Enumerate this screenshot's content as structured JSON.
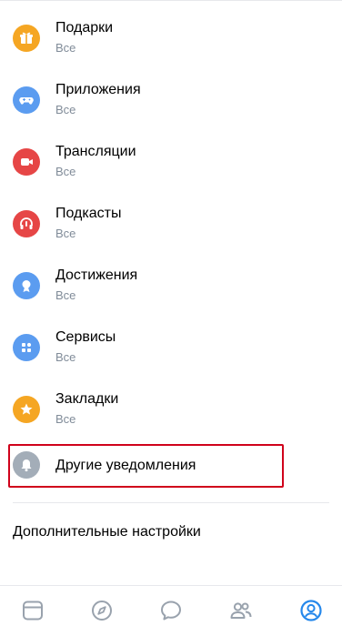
{
  "items": [
    {
      "title": "Подарки",
      "subtitle": "Все",
      "icon": "gift-icon",
      "color": "#f5a623"
    },
    {
      "title": "Приложения",
      "subtitle": "Все",
      "icon": "gamepad-icon",
      "color": "#5b9cf0"
    },
    {
      "title": "Трансляции",
      "subtitle": "Все",
      "icon": "video-camera-icon",
      "color": "#e64646"
    },
    {
      "title": "Подкасты",
      "subtitle": "Все",
      "icon": "headphones-icon",
      "color": "#e64646"
    },
    {
      "title": "Достижения",
      "subtitle": "Все",
      "icon": "medal-icon",
      "color": "#5b9cf0"
    },
    {
      "title": "Сервисы",
      "subtitle": "Все",
      "icon": "services-grid-icon",
      "color": "#5b9cf0"
    },
    {
      "title": "Закладки",
      "subtitle": "Все",
      "icon": "star-icon",
      "color": "#f5a623"
    }
  ],
  "other_notifications": {
    "title": "Другие уведомления",
    "icon": "bell-icon",
    "color": "#a3adb8"
  },
  "extra_settings_label": "Дополнительные настройки",
  "tabbar": {
    "tabs": [
      "newsfeed-icon",
      "explore-compass-icon",
      "messages-icon",
      "friends-icon",
      "profile-icon"
    ],
    "active_color": "#2688eb",
    "inactive_color": "#99a2ad"
  },
  "highlight_color": "#d0021b"
}
